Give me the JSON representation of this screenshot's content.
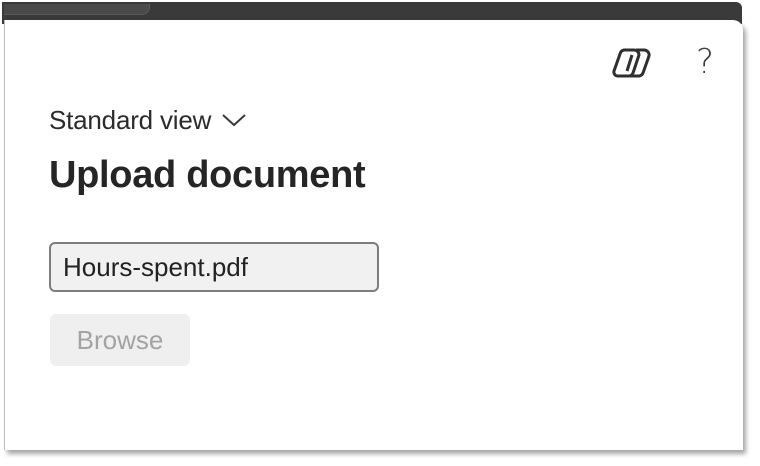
{
  "dialog": {
    "view_label": "Standard view",
    "title": "Upload document"
  },
  "header_icons": {
    "copilot": "copilot-icon",
    "help": "help-icon",
    "help_glyph": "?"
  },
  "upload": {
    "file_value": "Hours-spent.pdf",
    "browse_label": "Browse"
  },
  "colors": {
    "title_bar": "#3a3a3a",
    "disabled_button_bg": "#efefef",
    "disabled_button_text": "#a3a3a3",
    "field_bg": "#f1f1f1"
  }
}
